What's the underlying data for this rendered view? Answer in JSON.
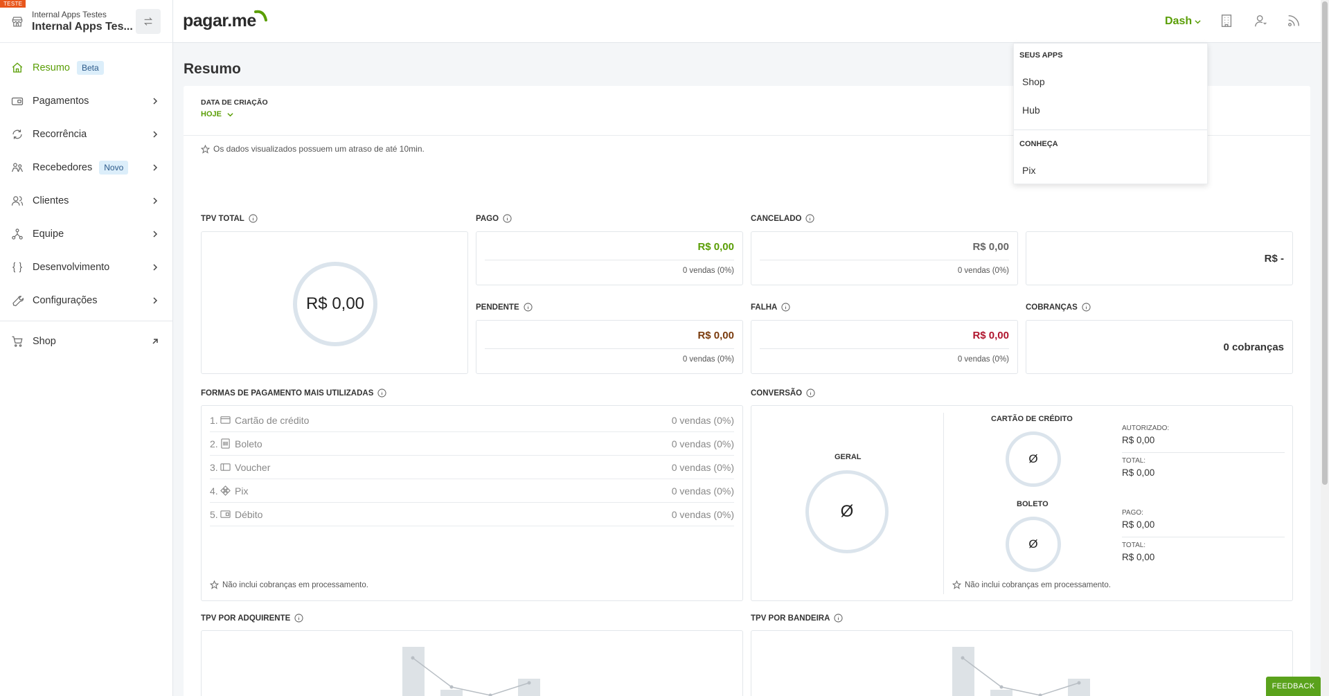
{
  "account": {
    "env_badge": "TESTE",
    "subtitle": "Internal Apps Testes",
    "title": "Internal Apps Tes..."
  },
  "sidebar": {
    "items": [
      {
        "label": "Resumo",
        "badge": "Beta",
        "icon": "home-icon"
      },
      {
        "label": "Pagamentos",
        "icon": "wallet-icon"
      },
      {
        "label": "Recorrência",
        "icon": "refresh-icon"
      },
      {
        "label": "Recebedores",
        "badge": "Novo",
        "icon": "people-icon"
      },
      {
        "label": "Clientes",
        "icon": "users-icon"
      },
      {
        "label": "Equipe",
        "icon": "team-icon"
      },
      {
        "label": "Desenvolvimento",
        "icon": "code-braces-icon"
      },
      {
        "label": "Configurações",
        "icon": "wrench-icon"
      },
      {
        "label": "Shop",
        "icon": "cart-icon"
      }
    ]
  },
  "header": {
    "logo_text": "pagar.me",
    "dash_label": "Dash"
  },
  "dropdown": {
    "section1_title": "SEUS APPS",
    "apps": [
      "Shop",
      "Hub"
    ],
    "section2_title": "CONHEÇA",
    "discover": [
      "Pix"
    ]
  },
  "page": {
    "title": "Resumo",
    "filter_label": "DATA DE CRIAÇÃO",
    "filter_value": "HOJE",
    "delay_note": "Os dados visualizados possuem um atraso de até 10min."
  },
  "tpv_total": {
    "label": "TPV TOTAL",
    "value": "R$ 0,00"
  },
  "cards": {
    "pago": {
      "label": "PAGO",
      "amount": "R$ 0,00",
      "sales": "0 vendas (0%)"
    },
    "cancelado": {
      "label": "CANCELADO",
      "amount": "R$ 0,00",
      "sales": "0 vendas (0%)"
    },
    "fourth": {
      "amount": "R$ -"
    },
    "pendente": {
      "label": "PENDENTE",
      "amount": "R$ 0,00",
      "sales": "0 vendas (0%)"
    },
    "falha": {
      "label": "FALHA",
      "amount": "R$ 0,00",
      "sales": "0 vendas (0%)"
    },
    "cobrancas": {
      "label": "COBRANÇAS",
      "value": "0 cobranças"
    }
  },
  "colors": {
    "accent_green": "#5a9e06",
    "pendente_amount": "#7a3b0d",
    "falha_amount": "#b0162e",
    "cancelado_amount": "#666666"
  },
  "payment_methods": {
    "label": "FORMAS DE PAGAMENTO MAIS UTILIZADAS",
    "rows": [
      {
        "num": "1.",
        "name": "Cartão de crédito",
        "sales": "0 vendas (0%)",
        "icon": "credit-card-icon"
      },
      {
        "num": "2.",
        "name": "Boleto",
        "sales": "0 vendas (0%)",
        "icon": "boleto-icon"
      },
      {
        "num": "3.",
        "name": "Voucher",
        "sales": "0 vendas (0%)",
        "icon": "voucher-icon"
      },
      {
        "num": "4.",
        "name": "Pix",
        "sales": "0 vendas (0%)",
        "icon": "pix-icon"
      },
      {
        "num": "5.",
        "name": "Débito",
        "sales": "0 vendas (0%)",
        "icon": "debit-card-icon"
      }
    ],
    "footnote": "Não inclui cobranças em processamento."
  },
  "conversion": {
    "label": "CONVERSÃO",
    "geral_title": "GERAL",
    "geral_value": "Ø",
    "credit_title": "CARTÃO DE CRÉDITO",
    "credit_value": "Ø",
    "boleto_title": "BOLETO",
    "boleto_value": "Ø",
    "autorizado_label": "AUTORIZADO:",
    "autorizado_value": "R$ 0,00",
    "total1_label": "TOTAL:",
    "total1_value": "R$ 0,00",
    "pago_label": "PAGO:",
    "pago_value": "R$ 0,00",
    "total2_label": "TOTAL:",
    "total2_value": "R$ 0,00",
    "footnote": "Não inclui cobranças em processamento."
  },
  "tpv_adquirente": {
    "label": "TPV POR ADQUIRENTE"
  },
  "tpv_bandeira": {
    "label": "TPV POR BANDEIRA"
  },
  "feedback_label": "FEEDBACK"
}
